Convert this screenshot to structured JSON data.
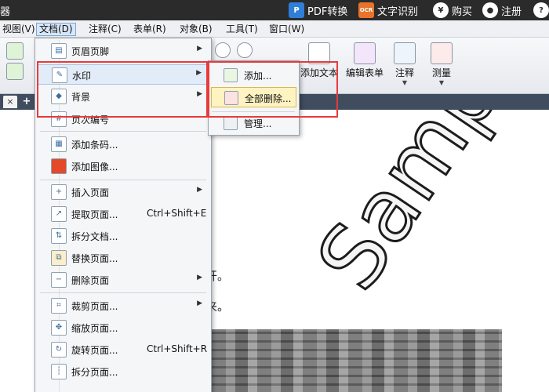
{
  "titlebar": {
    "left_text": "器",
    "pdf_convert": "PDF转换",
    "ocr_badge": "OCR",
    "ocr_label": "文字识别",
    "buy_symbol": "¥",
    "buy_label": "购买",
    "register_label": "注册",
    "help_symbol": "?"
  },
  "menubar": {
    "items": [
      "视图(V)",
      "文档(D)",
      "注释(C)",
      "表单(R)",
      "对象(B)",
      "工具(T)",
      "窗口(W)"
    ]
  },
  "toolbar": {
    "add_text": "添加文本",
    "edit_form": "编辑表单",
    "annotate": "注释",
    "measure": "测量"
  },
  "tabs": {
    "close_symbol": "×",
    "new_symbol": "+"
  },
  "document": {
    "line1": "开。",
    "line2": "来。",
    "watermark": "Sample"
  },
  "doc_menu": {
    "items": [
      {
        "label": "页眉页脚",
        "submenu": true
      },
      {
        "label": "水印",
        "submenu": true,
        "highlighted": true
      },
      {
        "label": "背景",
        "submenu": true
      },
      {
        "label": "页次编号",
        "submenu": false
      },
      {
        "label": "添加条码...",
        "submenu": false
      },
      {
        "label": "添加图像...",
        "submenu": false
      },
      {
        "label": "插入页面",
        "submenu": true
      },
      {
        "label": "提取页面...",
        "shortcut": "Ctrl+Shift+E"
      },
      {
        "label": "拆分文档...",
        "submenu": false
      },
      {
        "label": "替换页面...",
        "submenu": false
      },
      {
        "label": "删除页面",
        "submenu": true
      },
      {
        "label": "裁剪页面...",
        "submenu": true
      },
      {
        "label": "缩放页面...",
        "submenu": false
      },
      {
        "label": "旋转页面...",
        "shortcut": "Ctrl+Shift+R"
      },
      {
        "label": "拆分页面...",
        "submenu": false
      }
    ]
  },
  "watermark_submenu": {
    "items": [
      {
        "label": "添加..."
      },
      {
        "label": "全部删除...",
        "highlighted": true
      },
      {
        "label": "管理..."
      }
    ]
  },
  "colors": {
    "highlight_box": "#e83a3a",
    "menu_highlight": "#e2ecf8",
    "submenu_highlight": "#fff3c2"
  }
}
